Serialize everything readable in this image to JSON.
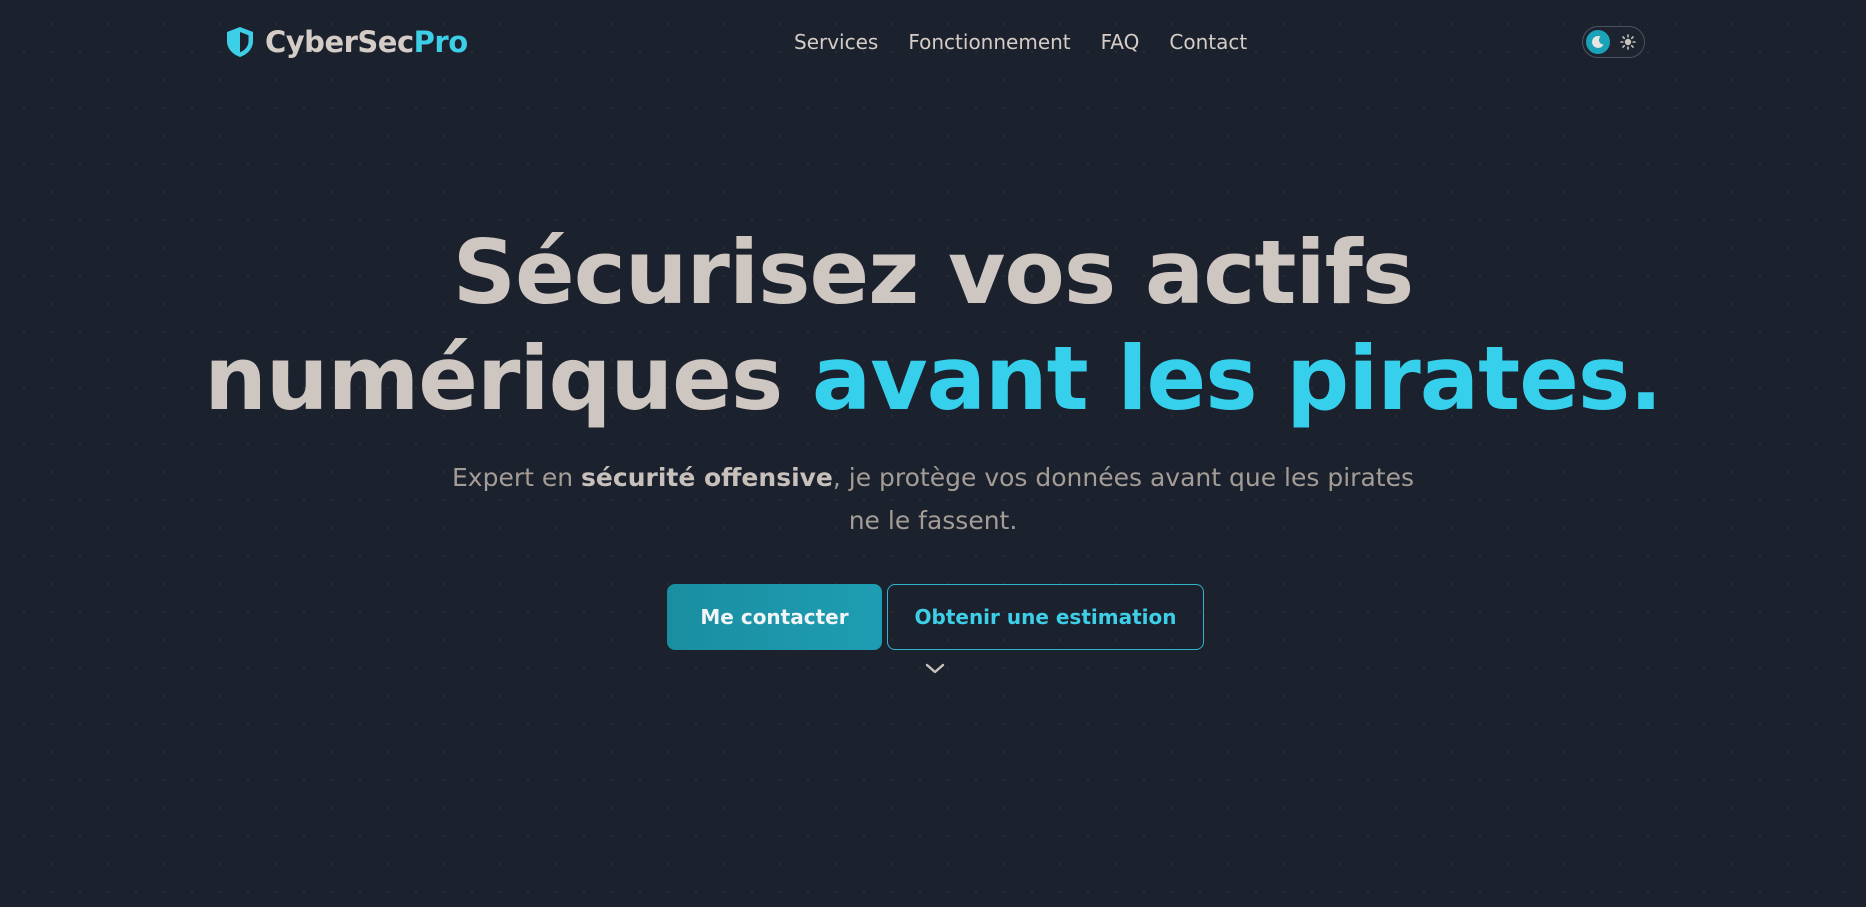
{
  "brand": {
    "name_main": "CyberSec",
    "name_accent": "Pro",
    "logo_icon": "shield-icon"
  },
  "nav": {
    "items": [
      {
        "label": "Services"
      },
      {
        "label": "Fonctionnement"
      },
      {
        "label": "FAQ"
      },
      {
        "label": "Contact"
      }
    ]
  },
  "theme_toggle": {
    "active_icon": "moon-icon",
    "inactive_icon": "sun-icon",
    "mode": "dark"
  },
  "hero": {
    "title_line1": "Sécurisez vos actifs",
    "title_line2_main": "numériques ",
    "title_line2_accent": "avant les pirates.",
    "subtitle_pre": "Expert en ",
    "subtitle_bold": "sécurité offensive",
    "subtitle_post": ", je protège vos données avant que les pirates ne le fassent.",
    "primary_button": "Me contacter",
    "secondary_button": "Obtenir une estimation",
    "scroll_icon": "chevron-down-icon"
  },
  "colors": {
    "background": "#1b212d",
    "accent": "#36d0ec",
    "text_primary": "#cec6c1",
    "text_muted": "#a49c96",
    "button_primary": "#1a96aa"
  }
}
